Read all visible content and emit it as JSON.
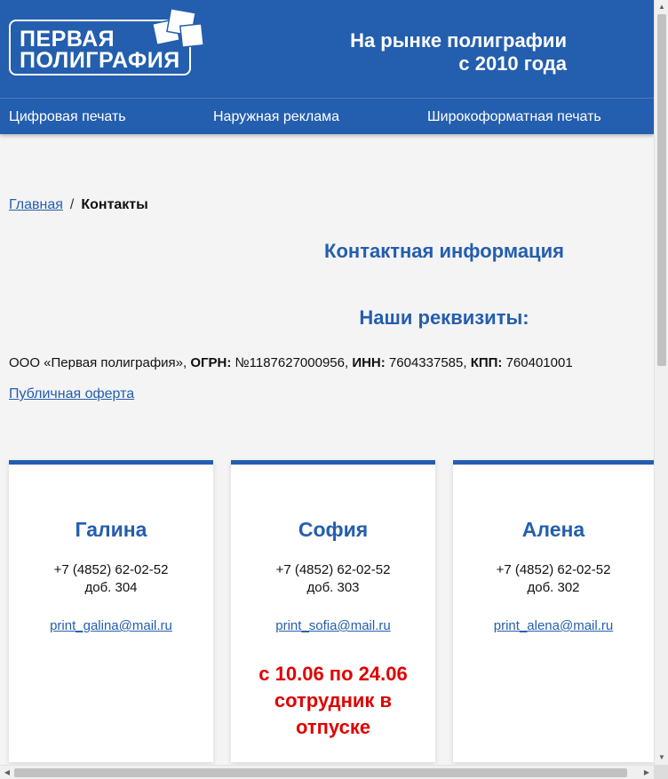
{
  "header": {
    "logo_line1": "ПЕРВАЯ",
    "logo_line2": "ПОЛИГРАФИЯ",
    "tagline_line1": "На рынке полиграфии",
    "tagline_line2": "с 2010 года"
  },
  "nav": {
    "items": [
      {
        "label": "Цифровая печать"
      },
      {
        "label": "Наружная реклама"
      },
      {
        "label": "Широкоформатная печать"
      }
    ]
  },
  "breadcrumb": {
    "home": "Главная",
    "separator": "/",
    "current": "Контакты"
  },
  "page": {
    "title": "Контактная информация",
    "requisites_title": "Наши реквизиты:",
    "company": "ООО «Первая полиграфия», ",
    "ogrn_label": "ОГРН:",
    "ogrn_value": " №1187627000956, ",
    "inn_label": "ИНН:",
    "inn_value": " 7604337585, ",
    "kpp_label": "КПП:",
    "kpp_value": " 760401001",
    "offer_link": "Публичная оферта"
  },
  "contacts": [
    {
      "name": "Галина",
      "phone": "+7 (4852) 62-02-52",
      "ext": "доб. 304",
      "email": "print_galina@mail.ru",
      "note_lines": []
    },
    {
      "name": "София",
      "phone": "+7 (4852) 62-02-52",
      "ext": "доб. 303",
      "email": "print_sofia@mail.ru",
      "note_lines": [
        "с 10.06 по 24.06",
        "сотрудник в",
        "отпуске"
      ]
    },
    {
      "name": "Алена",
      "phone": "+7 (4852) 62-02-52",
      "ext": "доб. 302",
      "email": "print_alena@mail.ru",
      "note_lines": []
    }
  ],
  "colors": {
    "brand_blue": "#245eae",
    "alert_red": "#e00000",
    "background": "#f4f4f4"
  }
}
